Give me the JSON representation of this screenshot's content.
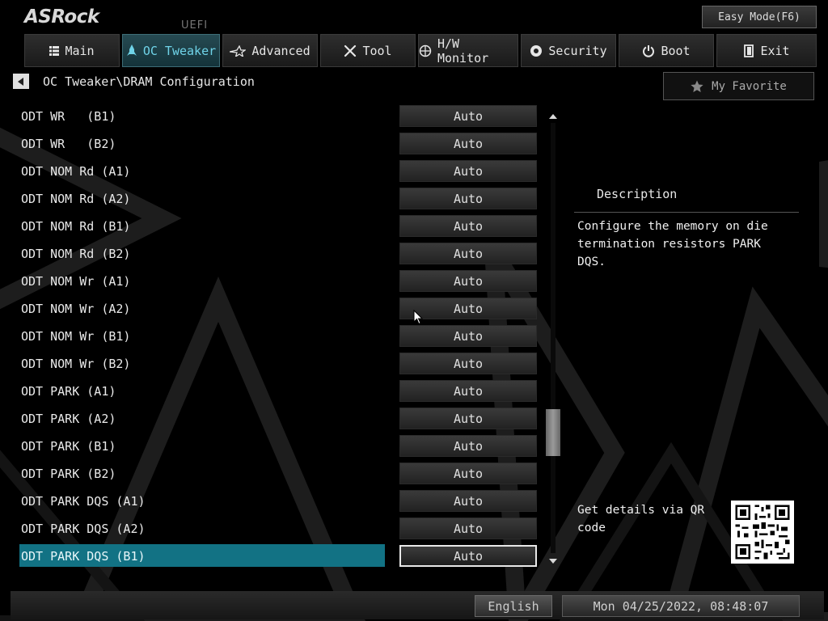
{
  "header": {
    "logo": "ASRock",
    "uefi_label": "UEFI",
    "easy_mode_label": "Easy Mode(F6)"
  },
  "nav": {
    "tabs": [
      {
        "label": "Main",
        "icon": "list-icon",
        "active": false
      },
      {
        "label": "OC Tweaker",
        "icon": "rocket-icon",
        "active": true
      },
      {
        "label": "Advanced",
        "icon": "star-plane-icon",
        "active": false
      },
      {
        "label": "Tool",
        "icon": "tools-icon",
        "active": false
      },
      {
        "label": "H/W Monitor",
        "icon": "monitor-globe-icon",
        "active": false
      },
      {
        "label": "Security",
        "icon": "shield-icon",
        "active": false
      },
      {
        "label": "Boot",
        "icon": "power-icon",
        "active": false
      },
      {
        "label": "Exit",
        "icon": "exit-door-icon",
        "active": false
      }
    ]
  },
  "breadcrumb": {
    "path": "OC Tweaker\\DRAM Configuration"
  },
  "favorite": {
    "label": "My Favorite"
  },
  "settings": {
    "items": [
      {
        "label": "ODT WR   (B1)",
        "value": "Auto"
      },
      {
        "label": "ODT WR   (B2)",
        "value": "Auto"
      },
      {
        "label": "ODT NOM Rd (A1)",
        "value": "Auto"
      },
      {
        "label": "ODT NOM Rd (A2)",
        "value": "Auto"
      },
      {
        "label": "ODT NOM Rd (B1)",
        "value": "Auto"
      },
      {
        "label": "ODT NOM Rd (B2)",
        "value": "Auto"
      },
      {
        "label": "ODT NOM Wr (A1)",
        "value": "Auto"
      },
      {
        "label": "ODT NOM Wr (A2)",
        "value": "Auto"
      },
      {
        "label": "ODT NOM Wr (B1)",
        "value": "Auto"
      },
      {
        "label": "ODT NOM Wr (B2)",
        "value": "Auto"
      },
      {
        "label": "ODT PARK (A1)",
        "value": "Auto"
      },
      {
        "label": "ODT PARK (A2)",
        "value": "Auto"
      },
      {
        "label": "ODT PARK (B1)",
        "value": "Auto"
      },
      {
        "label": "ODT PARK (B2)",
        "value": "Auto"
      },
      {
        "label": "ODT PARK DQS (A1)",
        "value": "Auto"
      },
      {
        "label": "ODT PARK DQS (A2)",
        "value": "Auto"
      },
      {
        "label": "ODT PARK DQS (B1)",
        "value": "Auto",
        "selected": true
      }
    ]
  },
  "description": {
    "title": "Description",
    "text": "Configure the memory on die termination resistors PARK DQS.",
    "qr_text": "Get details via QR code"
  },
  "footer": {
    "language": "English",
    "datetime": "Mon 04/25/2022, 08:48:07"
  },
  "colors": {
    "accent": "#127284",
    "active_tab_text": "#6fd3e8",
    "background": "#000000"
  }
}
